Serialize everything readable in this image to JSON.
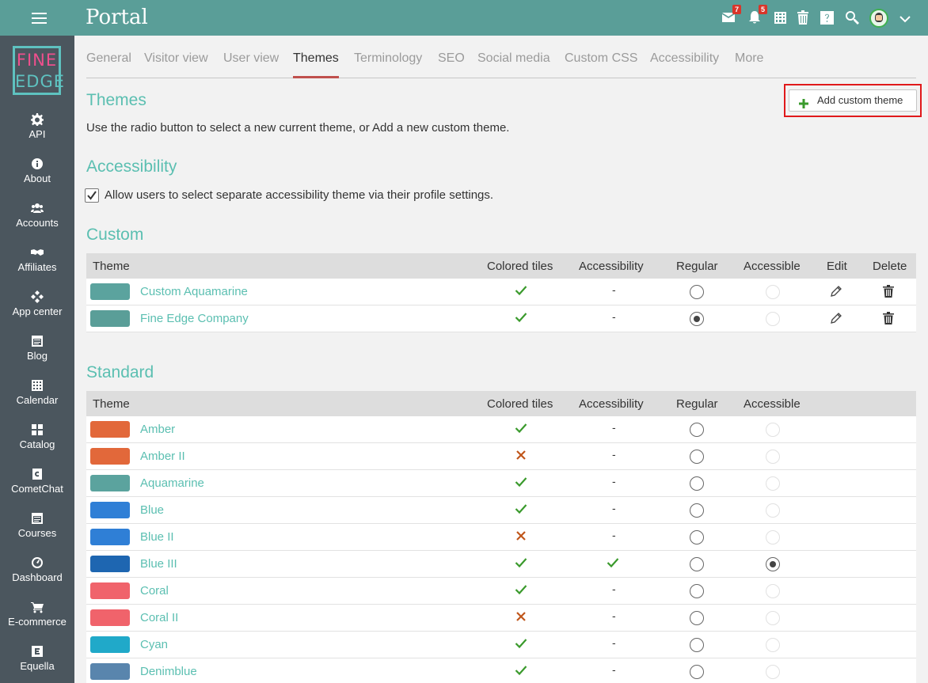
{
  "header": {
    "title": "Portal",
    "mail_badge": "7",
    "bell_badge": "5"
  },
  "logo": {
    "line1": "FINE",
    "line2": "EDGE"
  },
  "sidebar": {
    "items": [
      {
        "label": "API",
        "icon": "gear-icon"
      },
      {
        "label": "About",
        "icon": "info-icon"
      },
      {
        "label": "Accounts",
        "icon": "users-icon"
      },
      {
        "label": "Affiliates",
        "icon": "handshake-icon"
      },
      {
        "label": "App center",
        "icon": "diamond-grid-icon"
      },
      {
        "label": "Blog",
        "icon": "calendar-icon"
      },
      {
        "label": "Calendar",
        "icon": "calendar-grid-icon"
      },
      {
        "label": "Catalog",
        "icon": "tiles-icon"
      },
      {
        "label": "CometChat",
        "icon": "cometchat-icon"
      },
      {
        "label": "Courses",
        "icon": "calendar-icon"
      },
      {
        "label": "Dashboard",
        "icon": "gauge-icon"
      },
      {
        "label": "E-commerce",
        "icon": "cart-icon"
      },
      {
        "label": "Equella",
        "icon": "equella-icon"
      }
    ]
  },
  "tabs": [
    "General",
    "Visitor view",
    "User view",
    "Themes",
    "Terminology",
    "SEO",
    "Social media",
    "Custom CSS",
    "Accessibility",
    "More"
  ],
  "active_tab": "Themes",
  "themes_section": {
    "title": "Themes",
    "description": "Use the radio button to select a new current theme, or Add a new custom theme.",
    "add_button": "Add custom theme"
  },
  "accessibility_section": {
    "title": "Accessibility",
    "checkbox_label": "Allow users to select separate accessibility theme via their profile settings.",
    "checked": true
  },
  "custom_section": {
    "title": "Custom",
    "columns": [
      "Theme",
      "Colored tiles",
      "Accessibility",
      "Regular",
      "Accessible",
      "Edit",
      "Delete"
    ],
    "rows": [
      {
        "name": "Custom Aquamarine",
        "color": "#5ba39e",
        "tiles": "check",
        "access": "-",
        "regular": false,
        "accessible": false
      },
      {
        "name": "Fine Edge Company",
        "color": "#5a9e98",
        "tiles": "check",
        "access": "-",
        "regular": true,
        "accessible": false
      }
    ]
  },
  "standard_section": {
    "title": "Standard",
    "columns": [
      "Theme",
      "Colored tiles",
      "Accessibility",
      "Regular",
      "Accessible"
    ],
    "rows": [
      {
        "name": "Amber",
        "color": "#e2683a",
        "tiles": "check",
        "access": "-",
        "regular": false,
        "accessible": false
      },
      {
        "name": "Amber II",
        "color": "#e2683a",
        "tiles": "cross",
        "access": "-",
        "regular": false,
        "accessible": false
      },
      {
        "name": "Aquamarine",
        "color": "#5ba39e",
        "tiles": "check",
        "access": "-",
        "regular": false,
        "accessible": false
      },
      {
        "name": "Blue",
        "color": "#2f7fd6",
        "tiles": "check",
        "access": "-",
        "regular": false,
        "accessible": false
      },
      {
        "name": "Blue II",
        "color": "#2f7fd6",
        "tiles": "cross",
        "access": "-",
        "regular": false,
        "accessible": false
      },
      {
        "name": "Blue III",
        "color": "#1e66b1",
        "tiles": "check",
        "access": "check",
        "regular": false,
        "accessible": true
      },
      {
        "name": "Coral",
        "color": "#f0636b",
        "tiles": "check",
        "access": "-",
        "regular": false,
        "accessible": false
      },
      {
        "name": "Coral II",
        "color": "#f0636b",
        "tiles": "cross",
        "access": "-",
        "regular": false,
        "accessible": false
      },
      {
        "name": "Cyan",
        "color": "#20a9c9",
        "tiles": "check",
        "access": "-",
        "regular": false,
        "accessible": false
      },
      {
        "name": "Denimblue",
        "color": "#5985ad",
        "tiles": "check",
        "access": "-",
        "regular": false,
        "accessible": false
      }
    ]
  },
  "colors": {
    "header": "#5a9e98",
    "sidebar": "#4b565e",
    "accent": "#5bbfb1",
    "check": "#3a9a2c",
    "cross": "#c0561a"
  }
}
